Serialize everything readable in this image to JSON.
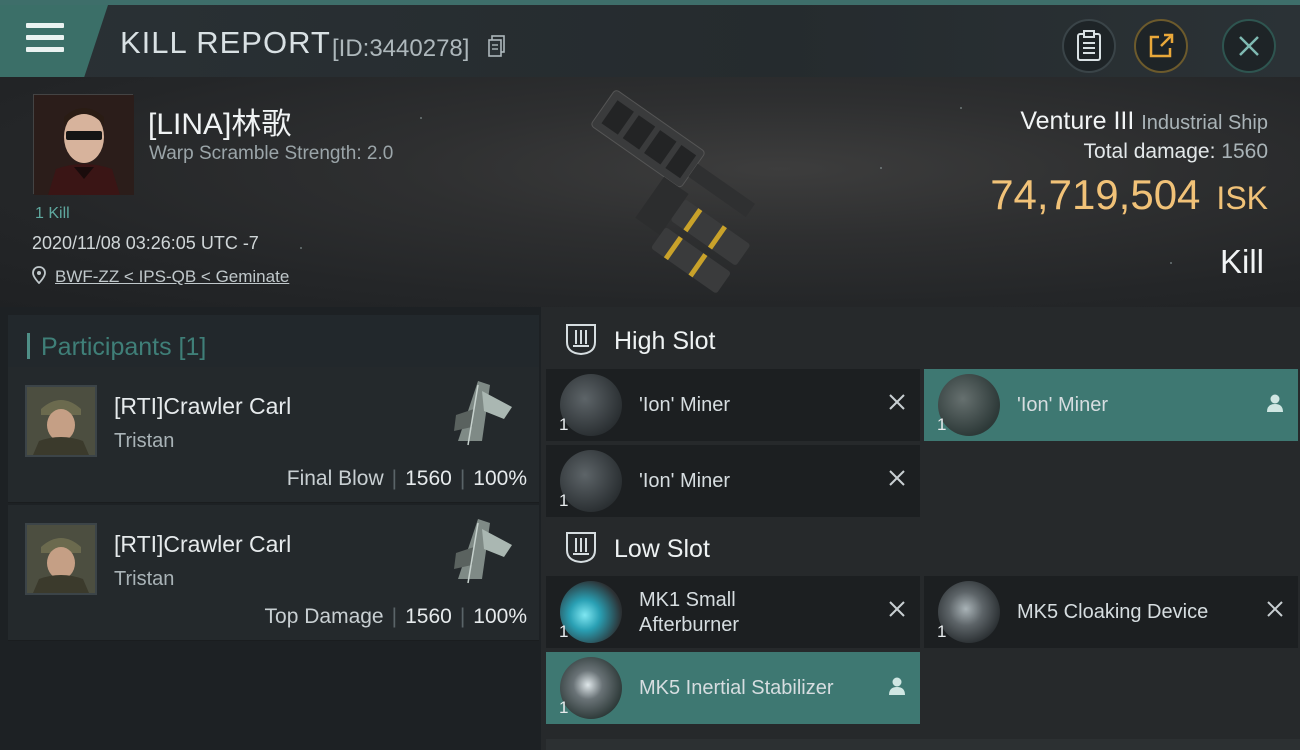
{
  "header": {
    "title": "KILL REPORT",
    "report_id": "[ID:3440278]",
    "buttons": [
      "clipboard",
      "share",
      "close"
    ]
  },
  "victim": {
    "name": "[LINA]林歌",
    "warp_scramble": "Warp Scramble Strength: 2.0",
    "kills_tag": "1 Kill",
    "timestamp": "2020/11/08 03:26:05 UTC -7",
    "location": "BWF-ZZ < IPS-QB < Geminate",
    "ship_name": "Venture III",
    "ship_class": "Industrial Ship",
    "total_damage_label": "Total damage:",
    "total_damage": "1560",
    "isk_value": "74,719,504",
    "isk_unit": "ISK",
    "outcome": "Kill"
  },
  "participants": {
    "label": "Participants [1]",
    "rows": [
      {
        "name": "[RTI]Crawler Carl",
        "ship": "Tristan",
        "role": "Final Blow",
        "damage": "1560",
        "percent": "100%"
      },
      {
        "name": "[RTI]Crawler Carl",
        "ship": "Tristan",
        "role": "Top Damage",
        "damage": "1560",
        "percent": "100%"
      }
    ]
  },
  "modules": {
    "high_slot": {
      "title": "High Slot",
      "items": [
        {
          "name": "'Ion' Miner",
          "qty": "1",
          "status": "destroyed"
        },
        {
          "name": "'Ion' Miner",
          "qty": "1",
          "status": "dropped"
        },
        {
          "name": "'Ion' Miner",
          "qty": "1",
          "status": "destroyed"
        }
      ]
    },
    "low_slot": {
      "title": "Low Slot",
      "items": [
        {
          "name_line1": "MK1 Small",
          "name_line2": "Afterburner",
          "qty": "1",
          "status": "destroyed"
        },
        {
          "name": "MK5 Cloaking Device",
          "qty": "1",
          "status": "destroyed"
        },
        {
          "name": "MK5 Inertial Stabilizer",
          "qty": "1",
          "status": "dropped"
        }
      ]
    }
  },
  "colors": {
    "accent_teal": "#3e7872",
    "isk_gold": "#f1c278",
    "panel_dark": "#1c1f21"
  }
}
